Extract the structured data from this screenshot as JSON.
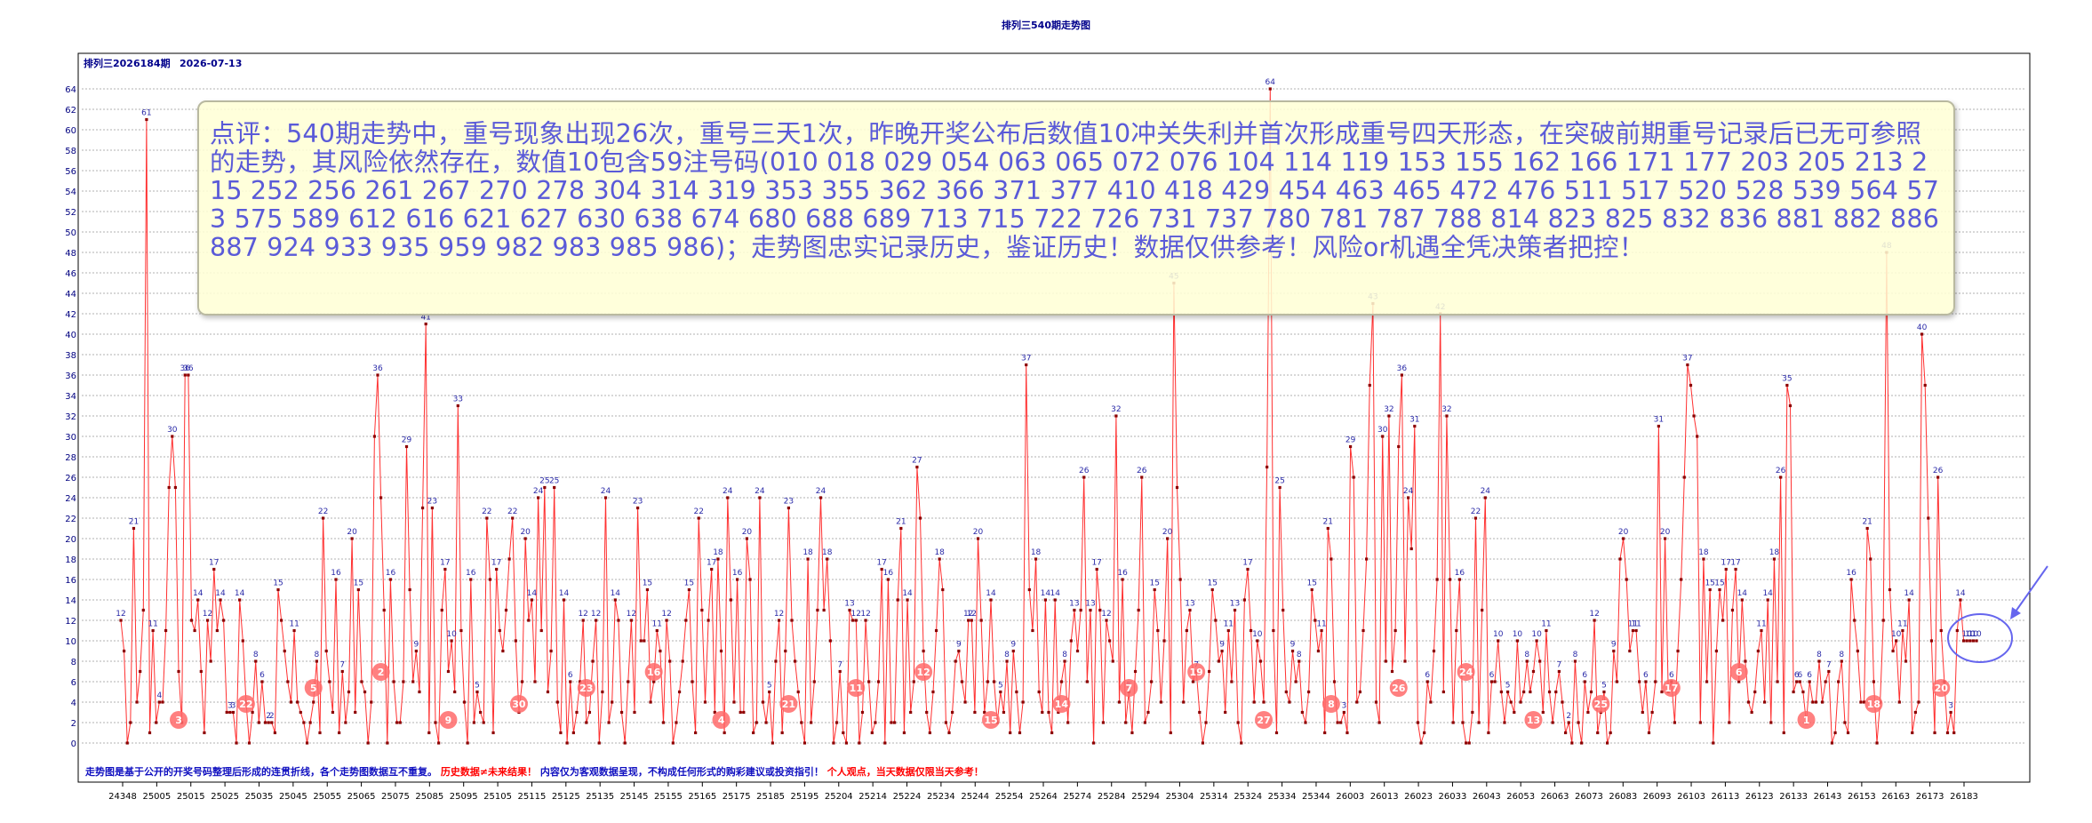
{
  "page_title": "排列三540期走势图",
  "header_issue": "排列三2026184期",
  "header_date": "2026-07-13",
  "comment": "点评：540期走势中，重号现象出现26次，重号三天1次，昨晚开奖公布后数值10冲关失利并首次形成重号四天形态，在突破前期重号记录后已无可参照的走势，其风险依然存在，数值10包含59注号码(010 018 029 054 063 065 072 076 104 114 119 153 155 162 166 171 177 203 205 213 215 252 256 261 267 270 278 304 314 319 353 355 362 366 371 377 410 418 429 454 463 465 472 476 511 517 520 528 539 564 573 575 589 612 616 621 627 630 638 674 680 688 689 713 715 722 726 731 737 780 781 787 788 814 823 825 832 836 881 882 886 887 924 933 935 959 982 983 985 986)；走势图忠实记录历史，鉴证历史！数据仅供参考！风险or机遇全凭决策者把控！",
  "footer": {
    "part1": "走势图是基于公开的开奖号码整理后形成的连贯折线，各个走势图数据互不重复。",
    "part2": "历史数据≠未来结果！",
    "part3": "内容仅为客观数据呈现，不构成任何形式的购彩建议或投资指引！",
    "part4": "个人观点，当天数据仅限当天参考！"
  },
  "colors": {
    "line": "#ff3030",
    "marker": "#8b0000",
    "value_label": "#2a2aa8",
    "badge": "#ff6a6a",
    "grid": "#b0b0b0",
    "axis_text": "#000080",
    "footer_blue": "#1010c0",
    "footer_red": "#ff0000",
    "circle": "#6666ee"
  },
  "chart_data": {
    "type": "line",
    "title": "排列三540期走势图",
    "ylim": [
      0,
      64
    ],
    "yticks": [
      0,
      2,
      4,
      6,
      8,
      10,
      12,
      14,
      16,
      18,
      20,
      22,
      24,
      26,
      28,
      30,
      32,
      34,
      36,
      38,
      40,
      42,
      44,
      46,
      48,
      50,
      52,
      54,
      56,
      58,
      60,
      62,
      64
    ],
    "xticks": [
      "24348",
      "25005",
      "25015",
      "25025",
      "25035",
      "25045",
      "25055",
      "25065",
      "25075",
      "25085",
      "25095",
      "25105",
      "25115",
      "25125",
      "25135",
      "25145",
      "25155",
      "25165",
      "25175",
      "25185",
      "25195",
      "25204",
      "25214",
      "25224",
      "25234",
      "25244",
      "25254",
      "25264",
      "25274",
      "25284",
      "25294",
      "25304",
      "25314",
      "25324",
      "25334",
      "25344",
      "26003",
      "26013",
      "26023",
      "26033",
      "26043",
      "26053",
      "26063",
      "26073",
      "26083",
      "26093",
      "26103",
      "26113",
      "26123",
      "26133",
      "26143",
      "26153",
      "26163",
      "26173",
      "26183"
    ],
    "grid": true,
    "series_count": 540,
    "notable_peaks": [
      {
        "issue_index": 8,
        "value": 61
      },
      {
        "issue_index": 337,
        "value": 64
      },
      {
        "issue_index": 306,
        "value": 45
      },
      {
        "issue_index": 383,
        "value": 43
      },
      {
        "issue_index": 393,
        "value": 45
      },
      {
        "issue_index": 407,
        "value": 42
      },
      {
        "issue_index": 520,
        "value": 48
      },
      {
        "issue_index": 528,
        "value": 40
      },
      {
        "issue_index": 478,
        "value": 39
      },
      {
        "issue_index": 95,
        "value": 41
      }
    ],
    "last_values": [
      10,
      10,
      10,
      10
    ],
    "badges": [
      3,
      22,
      5,
      2,
      9,
      30,
      23,
      16,
      4,
      21,
      11,
      12,
      15,
      14,
      7,
      19,
      27,
      8,
      26,
      24,
      13,
      25,
      17,
      6,
      1,
      18,
      20
    ],
    "values": [
      12,
      9,
      0,
      2,
      21,
      4,
      7,
      13,
      61,
      1,
      11,
      2,
      4,
      4,
      11,
      25,
      30,
      25,
      7,
      2,
      36,
      36,
      12,
      11,
      14,
      7,
      1,
      12,
      8,
      17,
      11,
      14,
      12,
      3,
      3,
      3,
      0,
      14,
      10,
      4,
      0,
      3,
      8,
      2,
      6,
      2,
      2,
      2,
      1,
      15,
      12,
      9,
      6,
      4,
      11,
      4,
      3,
      2,
      0,
      2,
      4,
      8,
      1,
      22,
      9,
      6,
      3,
      16,
      1,
      7,
      2,
      5,
      20,
      3,
      15,
      6,
      5,
      0,
      4,
      30,
      36,
      24,
      13,
      0,
      16,
      6,
      2,
      2,
      6,
      29,
      15,
      6,
      9,
      5,
      23,
      41,
      1,
      23,
      2,
      0,
      13,
      17,
      7,
      10,
      5,
      33,
      11,
      4,
      0,
      16,
      2,
      5,
      3,
      2,
      22,
      16,
      1,
      17,
      11,
      9,
      13,
      18,
      22,
      10,
      3,
      6,
      20,
      12,
      14,
      6,
      24,
      11,
      25,
      5,
      9,
      25,
      4,
      1,
      14,
      0,
      6,
      1,
      3,
      6,
      12,
      2,
      3,
      8,
      12,
      0,
      5,
      24,
      2,
      4,
      14,
      12,
      3,
      0,
      6,
      12,
      3,
      23,
      10,
      10,
      15,
      4,
      6,
      11,
      9,
      2,
      12,
      8,
      0,
      2,
      5,
      8,
      12,
      15,
      6,
      1,
      22,
      13,
      4,
      12,
      17,
      3,
      18,
      9,
      1,
      24,
      14,
      4,
      16,
      3,
      3,
      20,
      16,
      1,
      2,
      24,
      4,
      2,
      5,
      0,
      8,
      12,
      1,
      9,
      23,
      12,
      8,
      5,
      2,
      0,
      18,
      2,
      6,
      13,
      24,
      13,
      18,
      10,
      0,
      2,
      7,
      1,
      0,
      13,
      12,
      12,
      0,
      3,
      12,
      6,
      1,
      2,
      6,
      17,
      0,
      16,
      2,
      2,
      14,
      21,
      1,
      14,
      3,
      6,
      27,
      22,
      9,
      3,
      1,
      5,
      11,
      18,
      15,
      2,
      1,
      3,
      8,
      9,
      6,
      4,
      12,
      12,
      3,
      20,
      12,
      3,
      6,
      14,
      6,
      2,
      5,
      3,
      8,
      1,
      9,
      5,
      1,
      4,
      37,
      15,
      11,
      18,
      5,
      3,
      14,
      3,
      1,
      14,
      3,
      6,
      8,
      2,
      10,
      13,
      9,
      13,
      26,
      6,
      13,
      0,
      17,
      13,
      2,
      12,
      10,
      8,
      32,
      4,
      16,
      2,
      5,
      1,
      7,
      13,
      26,
      2,
      3,
      6,
      15,
      11,
      4,
      10,
      20,
      1,
      45,
      25,
      16,
      4,
      11,
      13,
      6,
      7,
      3,
      0,
      2,
      7,
      15,
      12,
      8,
      9,
      3,
      11,
      6,
      13,
      2,
      0,
      14,
      17,
      11,
      4,
      10,
      8,
      4,
      27,
      64,
      11,
      1,
      25,
      13,
      5,
      4,
      9,
      6,
      8,
      3,
      2,
      5,
      15,
      12,
      9,
      11,
      1,
      21,
      18,
      6,
      2,
      2,
      3,
      1,
      29,
      26,
      4,
      5,
      11,
      18,
      35,
      43,
      4,
      2,
      30,
      8,
      32,
      7,
      11,
      29,
      36,
      8,
      24,
      19,
      31,
      2,
      0,
      1,
      6,
      4,
      9,
      16,
      42,
      5,
      32,
      16,
      2,
      11,
      16,
      2,
      0,
      0,
      3,
      22,
      2,
      13,
      24,
      1,
      6,
      6,
      10,
      5,
      2,
      5,
      4,
      3,
      10,
      4,
      5,
      8,
      5,
      7,
      10,
      8,
      3,
      11,
      5,
      2,
      5,
      7,
      4,
      1,
      2,
      0,
      8,
      2,
      0,
      6,
      3,
      5,
      12,
      1,
      3,
      5,
      0,
      1,
      9,
      6,
      18,
      20,
      16,
      9,
      11,
      11,
      6,
      3,
      6,
      1,
      3,
      6,
      31,
      5,
      20,
      5,
      6,
      2,
      9,
      16,
      26,
      37,
      35,
      32,
      30,
      2,
      18,
      6,
      15,
      0,
      9,
      15,
      12,
      17,
      2,
      13,
      17,
      6,
      14,
      8,
      4,
      3,
      5,
      9,
      11,
      4,
      14,
      2,
      18,
      6,
      26,
      1,
      35,
      33,
      5,
      6,
      6,
      5,
      2,
      6,
      4,
      4,
      8,
      4,
      6,
      7,
      0,
      1,
      6,
      8,
      2,
      1,
      16,
      12,
      9,
      4,
      4,
      21,
      18,
      6,
      0,
      4,
      12,
      48,
      15,
      9,
      10,
      4,
      11,
      8,
      14,
      1,
      3,
      4,
      40,
      35,
      22,
      10,
      1,
      26,
      11,
      6,
      1,
      3,
      1,
      11,
      14,
      10,
      10,
      10,
      10,
      10
    ],
    "xlabel": "",
    "ylabel": ""
  }
}
